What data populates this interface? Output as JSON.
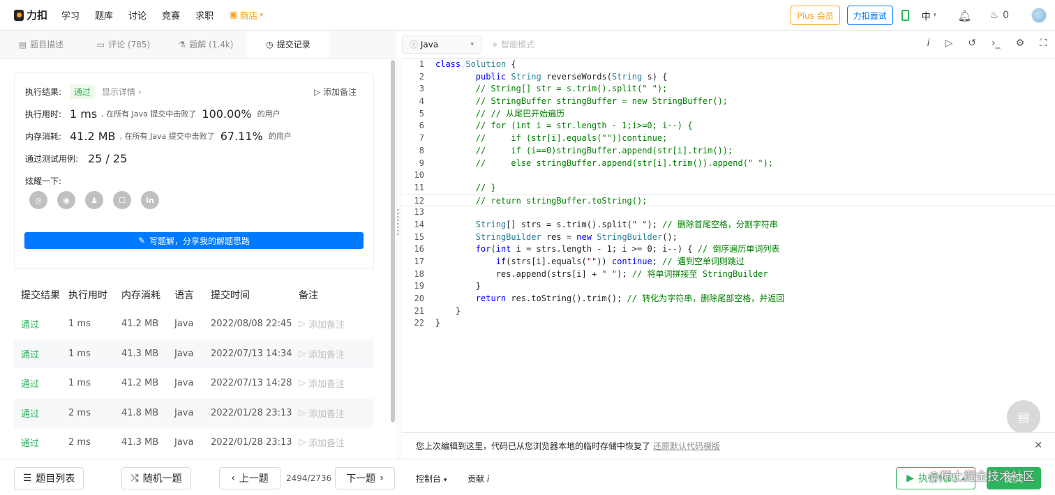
{
  "topbar": {
    "logo": "力扣",
    "nav": [
      "学习",
      "题库",
      "讨论",
      "竞赛",
      "求职"
    ],
    "shop": "商店",
    "plus": "Plus 会员",
    "interview": "力扣面试",
    "lang": "中",
    "fire_count": "0"
  },
  "tabs": [
    {
      "label": "题目描述"
    },
    {
      "label": "评论 (785)"
    },
    {
      "label": "题解 (1.4k)"
    },
    {
      "label": "提交记录"
    }
  ],
  "result": {
    "label": "执行结果:",
    "status": "通过",
    "detail": "显示详情 ›",
    "add_note": "添加备注",
    "time_label": "执行用时:",
    "time_value": "1 ms",
    "time_beat_prefix": ", 在所有 Java 提交中击败了",
    "time_pct": "100.00%",
    "users": "的用户",
    "mem_label": "内存消耗:",
    "mem_value": "41.2 MB",
    "mem_beat_prefix": ", 在所有 Java 提交中击败了",
    "mem_pct": "67.11%",
    "tests_label": "通过测试用例:",
    "tests_value": "25  /  25",
    "share_label": "炫耀一下:",
    "share_icons": [
      "wechat-icon",
      "weibo-icon",
      "qq-icon",
      "douban-icon",
      "linkedin-icon"
    ],
    "write_solution": "写题解，分享我的解题思路"
  },
  "table": {
    "headers": [
      "提交结果",
      "执行用时",
      "内存消耗",
      "语言",
      "提交时间",
      "备注"
    ],
    "rows": [
      {
        "status": "通过",
        "time": "1 ms",
        "mem": "41.2 MB",
        "lang": "Java",
        "date": "2022/08/08 22:45",
        "note": "添加备注"
      },
      {
        "status": "通过",
        "time": "1 ms",
        "mem": "41.3 MB",
        "lang": "Java",
        "date": "2022/07/13 14:34",
        "note": "添加备注"
      },
      {
        "status": "通过",
        "time": "1 ms",
        "mem": "41.2 MB",
        "lang": "Java",
        "date": "2022/07/13 14:28",
        "note": "添加备注"
      },
      {
        "status": "通过",
        "time": "2 ms",
        "mem": "41.8 MB",
        "lang": "Java",
        "date": "2022/01/28 23:13",
        "note": "添加备注"
      },
      {
        "status": "通过",
        "time": "2 ms",
        "mem": "41.3 MB",
        "lang": "Java",
        "date": "2022/01/28 23:13",
        "note": "添加备注"
      }
    ]
  },
  "footer_left": {
    "list": "题目列表",
    "random": "随机一题",
    "prev": "上一题",
    "pager": "2494/2736",
    "next": "下一题"
  },
  "editor": {
    "language": "Java",
    "smart_mode": "智能模式",
    "restore_text": "您上次编辑到这里，代码已从您浏览器本地的临时存储中恢复了",
    "restore_link": "还原默认代码模版",
    "console": "控制台",
    "contribute": "贡献",
    "run": "执行代码",
    "submit": "提交",
    "watermark": "@稀土掘金技术社区"
  },
  "code_lines": [
    "class Solution {",
    "        public String reverseWords(String s) {",
    "        // String[] str = s.trim().split(\" \");",
    "        // StringBuffer stringBuffer = new StringBuffer();",
    "        // // 从尾巴开始遍历",
    "        // for (int i = str.length - 1;i>=0; i--) {",
    "        //     if (str[i].equals(\"\"))continue;",
    "        //     if (i==0)stringBuffer.append(str[i].trim());",
    "        //     else stringBuffer.append(str[i].trim()).append(\" \");",
    "",
    "        // }",
    "        // return stringBuffer.toString();",
    "",
    "        String[] strs = s.trim().split(\" \"); // 删除首尾空格，分割字符串",
    "        StringBuilder res = new StringBuilder();",
    "        for(int i = strs.length - 1; i >= 0; i--) { // 倒序遍历单词列表",
    "            if(strs[i].equals(\"\")) continue; // 遇到空单词则跳过",
    "            res.append(strs[i] + \" \"); // 将单词拼接至 StringBuilder",
    "        }",
    "        return res.toString().trim(); // 转化为字符串，删除尾部空格，并返回",
    "    }",
    "}"
  ],
  "current_line": 12,
  "colors": {
    "accent": "#007aff",
    "success": "#2db55d",
    "brand": "#ffa116"
  }
}
